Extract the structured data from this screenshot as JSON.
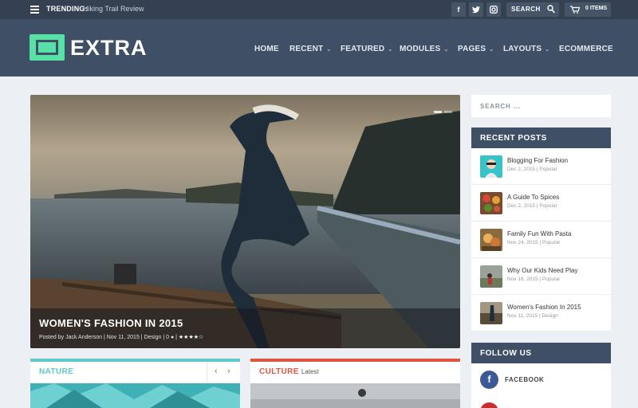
{
  "topbar": {
    "trending_label": "TRENDING:",
    "trending_link": "Hiking Trail Review",
    "social": [
      {
        "icon": "facebook-icon",
        "glyph": "f"
      },
      {
        "icon": "twitter-icon",
        "glyph": "t"
      },
      {
        "icon": "instagram-icon",
        "glyph": "◙"
      }
    ],
    "search_label": "SEARCH",
    "cart_label": "0 ITEMS"
  },
  "header": {
    "logo_text": "EXTRA",
    "nav": [
      {
        "label": "HOME",
        "dropdown": false
      },
      {
        "label": "RECENT",
        "dropdown": true
      },
      {
        "label": "FEATURED",
        "dropdown": true
      },
      {
        "label": "MODULES",
        "dropdown": true
      },
      {
        "label": "PAGES",
        "dropdown": true
      },
      {
        "label": "LAYOUTS",
        "dropdown": true
      },
      {
        "label": "ECOMMERCE",
        "dropdown": false
      }
    ]
  },
  "hero": {
    "title": "WOMEN'S FASHION IN 2015",
    "meta_prefix": "Posted by ",
    "author": "Jack Anderson",
    "date": "Nov 11, 2015",
    "category": "Design",
    "comments": "0",
    "rating": 4
  },
  "cards": [
    {
      "title": "NATURE",
      "subtitle": "",
      "color": "#5fc8c8"
    },
    {
      "title": "CULTURE",
      "subtitle": "Latest",
      "color": "#e0533f"
    }
  ],
  "sidebar": {
    "search_placeholder": "SEARCH ...",
    "recent_title": "RECENT POSTS",
    "posts": [
      {
        "title": "Blogging For Fashion",
        "meta": "Dec 2, 2015 | Popular"
      },
      {
        "title": "A Guide To Spices",
        "meta": "Dec 2, 2015 | Popular"
      },
      {
        "title": "Family Fun With Pasta",
        "meta": "Nov 24, 2015 | Popular"
      },
      {
        "title": "Why Our Kids Need Play",
        "meta": "Nov 18, 2015 | Popular"
      },
      {
        "title": "Women's Fashion In 2015",
        "meta": "Nov 11, 2015 | Design"
      }
    ],
    "follow_title": "FOLLOW US",
    "facebook_label": "FACEBOOK"
  },
  "colors": {
    "accent": "#57e1a7",
    "header_bg": "#3f4f66",
    "topbar_bg": "#354153"
  }
}
